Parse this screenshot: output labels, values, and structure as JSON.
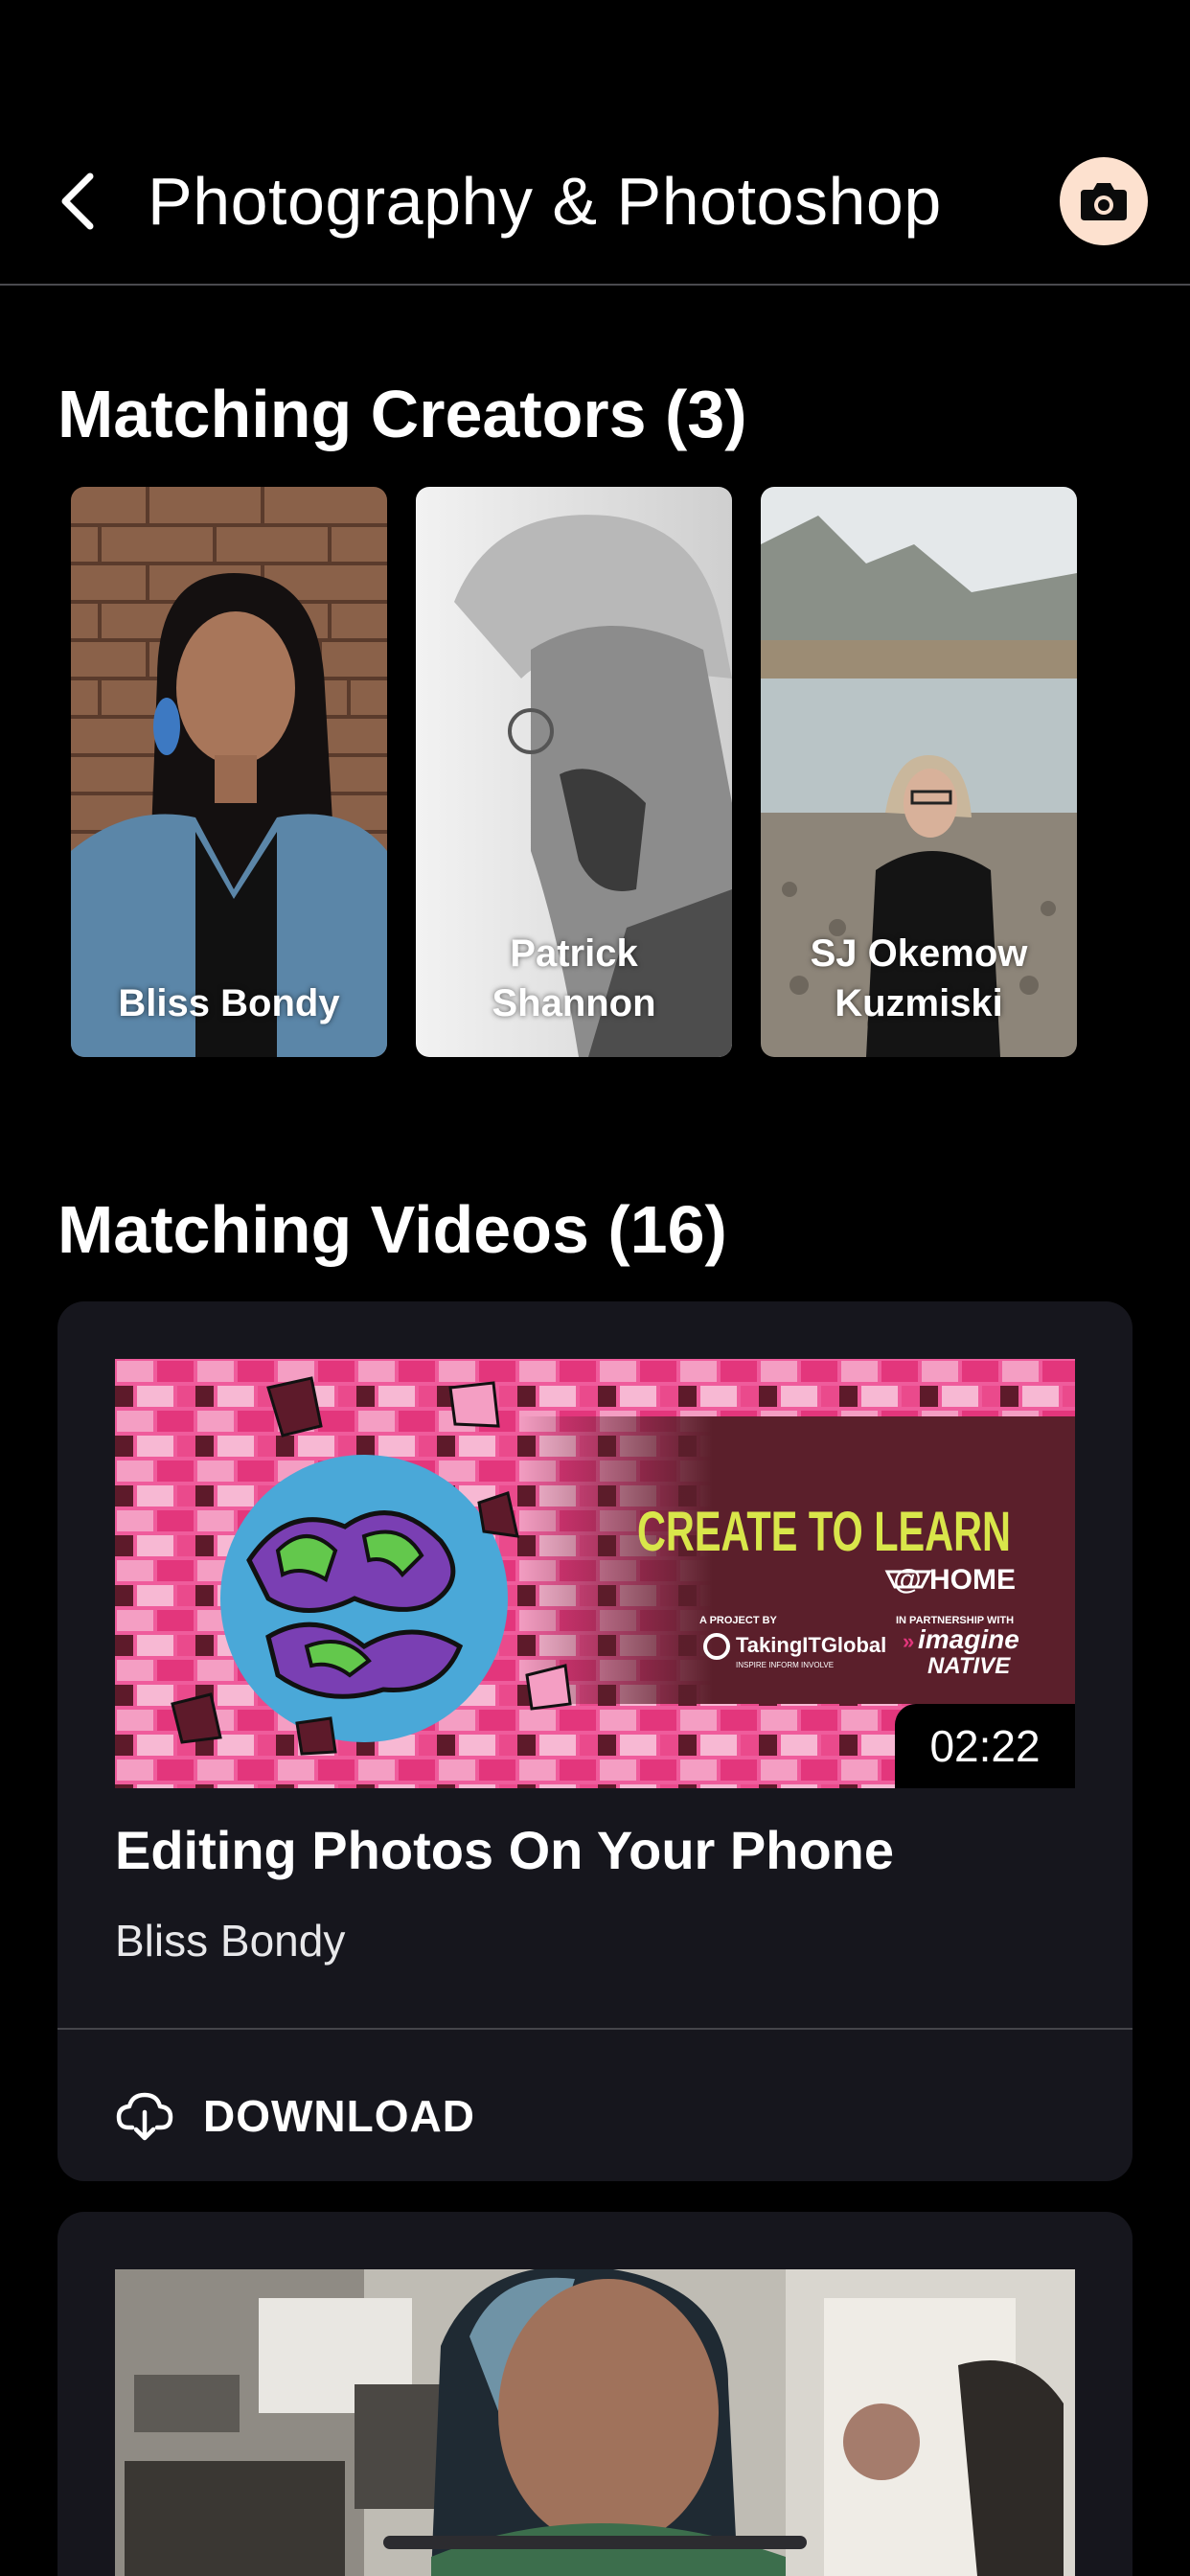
{
  "header": {
    "title": "Photography & Photoshop",
    "back_icon": "chevron-left-icon",
    "camera_icon": "camera-icon"
  },
  "creators": {
    "title": "Matching Creators (3)",
    "items": [
      {
        "name": "Bliss Bondy"
      },
      {
        "name": "Patrick Shannon"
      },
      {
        "name": "SJ Okemow Kuzmiski"
      }
    ]
  },
  "videos": {
    "title": "Matching Videos (16)",
    "items": [
      {
        "thumbnail": {
          "headline": "CREATE TO LEARN",
          "subline": "@ HOME",
          "project_by": "A PROJECT BY",
          "partner_label": "IN PARTNERSHIP WITH",
          "logo_taking": "TakingITGlobal",
          "logo_taking_tagline": "INSPIRE INFORM INVOLVE",
          "logo_imagine_1": "imagine",
          "logo_imagine_2": "NATIVE"
        },
        "duration": "02:22",
        "title": "Editing Photos On Your Phone",
        "creator": "Bliss Bondy",
        "download_label": "DOWNLOAD",
        "download_icon": "cloud-download-icon"
      }
    ]
  },
  "colors": {
    "background": "#000000",
    "card": "#16161d",
    "camera_button": "#fde1cf",
    "headline_yellow": "#d9e64a"
  }
}
